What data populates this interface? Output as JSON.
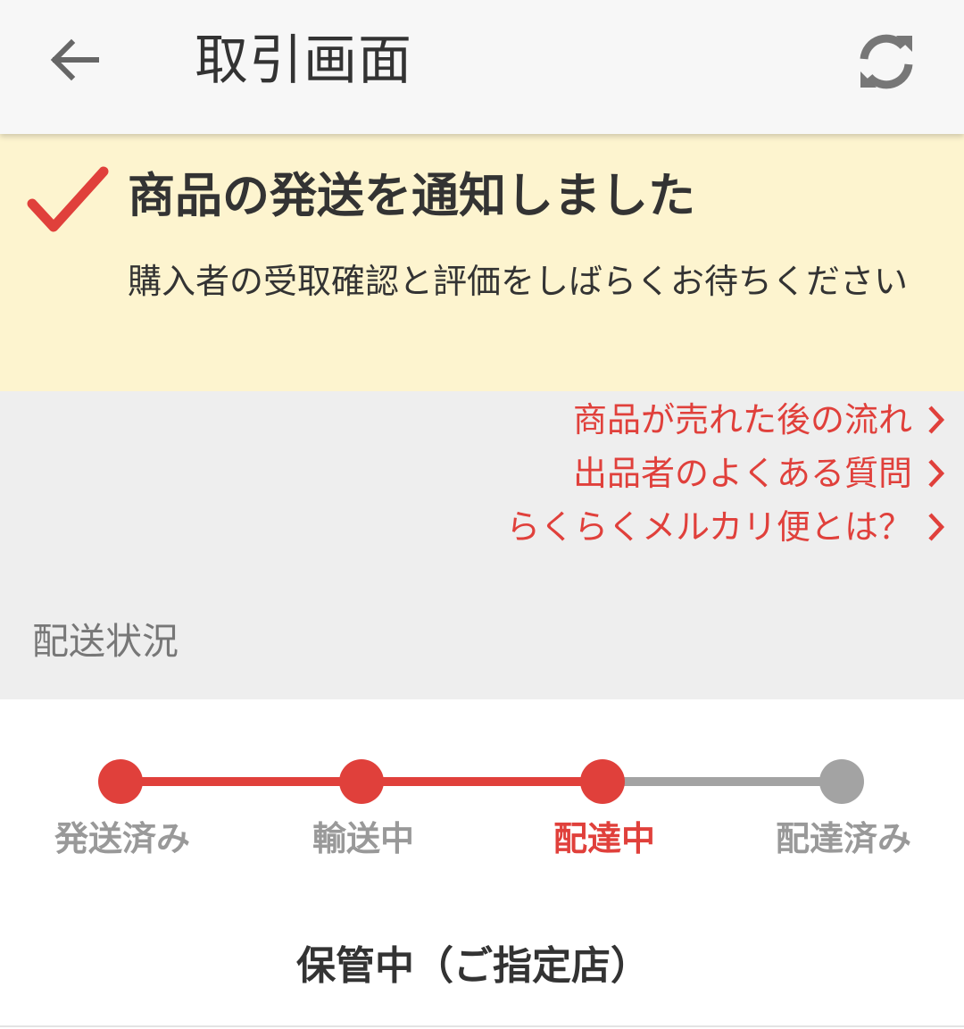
{
  "header": {
    "back_icon": "arrow-left-icon",
    "title": "取引画面",
    "refresh_icon": "refresh-icon"
  },
  "notice": {
    "icon": "checkmark-icon",
    "title": "商品の発送を通知しました",
    "body": "購入者の受取確認と評価をしばらくお待ちください"
  },
  "help_links": [
    {
      "label": "商品が売れた後の流れ",
      "icon": "chevron-right-icon"
    },
    {
      "label": "出品者のよくある質問",
      "icon": "chevron-right-icon"
    },
    {
      "label": "らくらくメルカリ便とは？",
      "icon": "chevron-right-icon"
    }
  ],
  "delivery": {
    "section_title": "配送状況",
    "steps": [
      {
        "label": "発送済み",
        "state": "done"
      },
      {
        "label": "輸送中",
        "state": "done"
      },
      {
        "label": "配達中",
        "state": "current"
      },
      {
        "label": "配達済み",
        "state": "pending"
      }
    ],
    "status": "保管中（ご指定店）"
  },
  "colors": {
    "accent": "#e0403b",
    "pending": "#a3a3a3",
    "notice_bg": "#fdf4cf",
    "grey_bg": "#eeeeee"
  }
}
